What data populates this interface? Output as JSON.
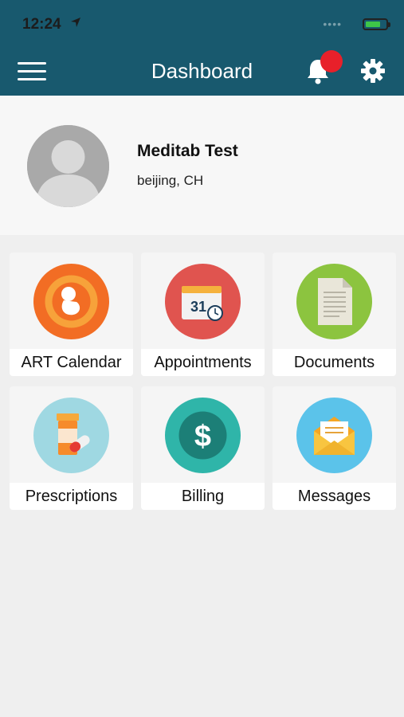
{
  "status_bar": {
    "time": "12:24"
  },
  "header": {
    "title": "Dashboard"
  },
  "profile": {
    "name": "Meditab Test",
    "location": "beijing, CH"
  },
  "tiles": [
    {
      "label": "ART Calendar",
      "icon": "fetus-icon",
      "color": "#f26d24"
    },
    {
      "label": "Appointments",
      "icon": "calendar-icon",
      "color": "#e0544f"
    },
    {
      "label": "Documents",
      "icon": "document-icon",
      "color": "#8cc43f"
    },
    {
      "label": "Prescriptions",
      "icon": "pill-bottle-icon",
      "color": "#9fd8e2"
    },
    {
      "label": "Billing",
      "icon": "dollar-icon",
      "color": "#2fb5a9"
    },
    {
      "label": "Messages",
      "icon": "envelope-icon",
      "color": "#5bc3ea"
    }
  ],
  "calendar_day": "31",
  "colors": {
    "header_bg": "#18596e",
    "notification": "#e8202a"
  }
}
